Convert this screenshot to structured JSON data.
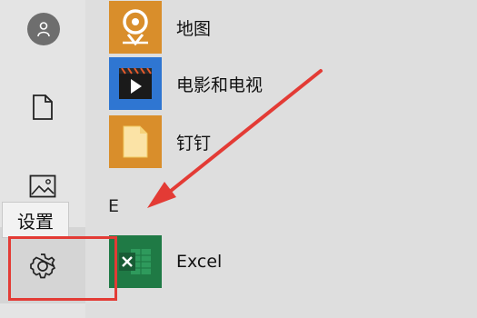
{
  "rail": {
    "tooltip": "设置",
    "icons": [
      "user-avatar-icon",
      "document-icon",
      "pictures-icon",
      "gear-icon"
    ]
  },
  "apps": [
    {
      "label": "地图",
      "icon": "maps-icon",
      "color": "#d98e2b"
    },
    {
      "label": "电影和电视",
      "icon": "movies-tv-icon",
      "color": "#2f76d2"
    },
    {
      "label": "钉钉",
      "icon": "folder-icon",
      "color": "#d98e2b"
    },
    {
      "label": "Excel",
      "icon": "excel-icon",
      "color": "#1f7a45"
    }
  ],
  "section_letter": "E",
  "colors": {
    "annotation_red": "#e33b35",
    "tile_orange": "#d98e2b",
    "tile_blue": "#2f76d2",
    "excel_green": "#1f7a45"
  }
}
